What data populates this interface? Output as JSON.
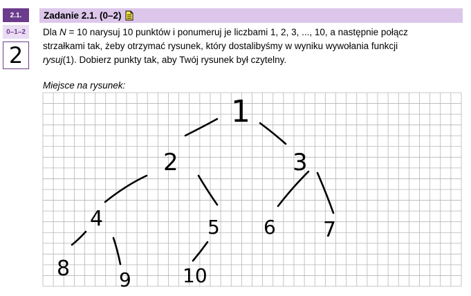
{
  "task": {
    "number": "2.1.",
    "points": "0–1–2",
    "score_handwritten": "2"
  },
  "header": {
    "title": "Zadanie 2.1. (0–2)",
    "icon": "note-icon"
  },
  "instruction": {
    "p1_a": "Dla ",
    "p1_N": "N",
    "p1_b": " = 10 narysuj 10 punktów i ponumeruj je liczbami 1, 2, 3, ..., 10, a następnie połącz",
    "line2": "strzałkami tak, żeby otrzymać rysunek, który dostalibyśmy w wyniku wywołania funkcji",
    "line3_func": "rysuj",
    "line3_rest": "(1). Dobierz punkty tak, aby Twój rysunek był czytelny."
  },
  "drawing_area": {
    "label": "Miejsce na rysunek:",
    "nodes": [
      "1",
      "2",
      "3",
      "4",
      "5",
      "6",
      "7",
      "8",
      "9",
      "10"
    ]
  },
  "colors": {
    "purple_dark": "#6b3c8c",
    "purple_light": "#dcc6ea",
    "grid": "#b5b5b5"
  }
}
